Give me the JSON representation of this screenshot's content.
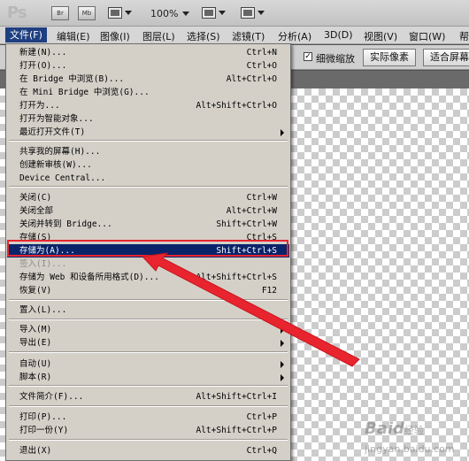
{
  "appbar": {
    "logo": "Ps",
    "br_label": "Br",
    "mb_label": "Mb",
    "zoom": "100%"
  },
  "menubar": {
    "items": [
      "文件(F)",
      "编辑(E)",
      "图像(I)",
      "图层(L)",
      "选择(S)",
      "滤镜(T)",
      "分析(A)",
      "3D(D)",
      "视图(V)",
      "窗口(W)",
      "帮"
    ]
  },
  "optbar": {
    "checkbox_label": "细微缩放",
    "checkbox_checked": true,
    "actual_pixels": "实际像素",
    "fit_screen": "适合屏幕"
  },
  "menu": {
    "items": [
      {
        "label": "新建(N)...",
        "shortcut": "Ctrl+N"
      },
      {
        "label": "打开(O)...",
        "shortcut": "Ctrl+O"
      },
      {
        "label": "在 Bridge 中浏览(B)...",
        "shortcut": "Alt+Ctrl+O"
      },
      {
        "label": "在 Mini Bridge 中浏览(G)...",
        "shortcut": ""
      },
      {
        "label": "打开为...",
        "shortcut": "Alt+Shift+Ctrl+O"
      },
      {
        "label": "打开为智能对象...",
        "shortcut": ""
      },
      {
        "label": "最近打开文件(T)",
        "shortcut": "",
        "submenu": true
      },
      {
        "label": "共享我的屏幕(H)...",
        "shortcut": ""
      },
      {
        "label": "创建新审核(W)...",
        "shortcut": ""
      },
      {
        "label": "Device Central...",
        "shortcut": ""
      },
      {
        "label": "关闭(C)",
        "shortcut": "Ctrl+W"
      },
      {
        "label": "关闭全部",
        "shortcut": "Alt+Ctrl+W"
      },
      {
        "label": "关闭并转到 Bridge...",
        "shortcut": "Shift+Ctrl+W"
      },
      {
        "label": "存储(S)",
        "shortcut": "Ctrl+S"
      },
      {
        "label": "存储为(A)...",
        "shortcut": "Shift+Ctrl+S",
        "selected": true
      },
      {
        "label": "签入(I)...",
        "shortcut": "",
        "disabled": true
      },
      {
        "label": "存储为 Web 和设备所用格式(D)...",
        "shortcut": "Alt+Shift+Ctrl+S"
      },
      {
        "label": "恢复(V)",
        "shortcut": "F12"
      },
      {
        "label": "置入(L)...",
        "shortcut": ""
      },
      {
        "label": "导入(M)",
        "shortcut": "",
        "submenu": true
      },
      {
        "label": "导出(E)",
        "shortcut": "",
        "submenu": true
      },
      {
        "label": "自动(U)",
        "shortcut": "",
        "submenu": true
      },
      {
        "label": "脚本(R)",
        "shortcut": "",
        "submenu": true
      },
      {
        "label": "文件简介(F)...",
        "shortcut": "Alt+Shift+Ctrl+I"
      },
      {
        "label": "打印(P)...",
        "shortcut": "Ctrl+P"
      },
      {
        "label": "打印一份(Y)",
        "shortcut": "Alt+Shift+Ctrl+P"
      },
      {
        "label": "退出(X)",
        "shortcut": "Ctrl+Q"
      }
    ]
  },
  "watermark": {
    "brand": "Baid",
    "suffix": "经验",
    "url": "jingyan.baidu.com"
  },
  "colors": {
    "menu_selected": "#0a246a",
    "annotation_red": "#e8252f",
    "menu_bg": "#d4d0c8"
  }
}
